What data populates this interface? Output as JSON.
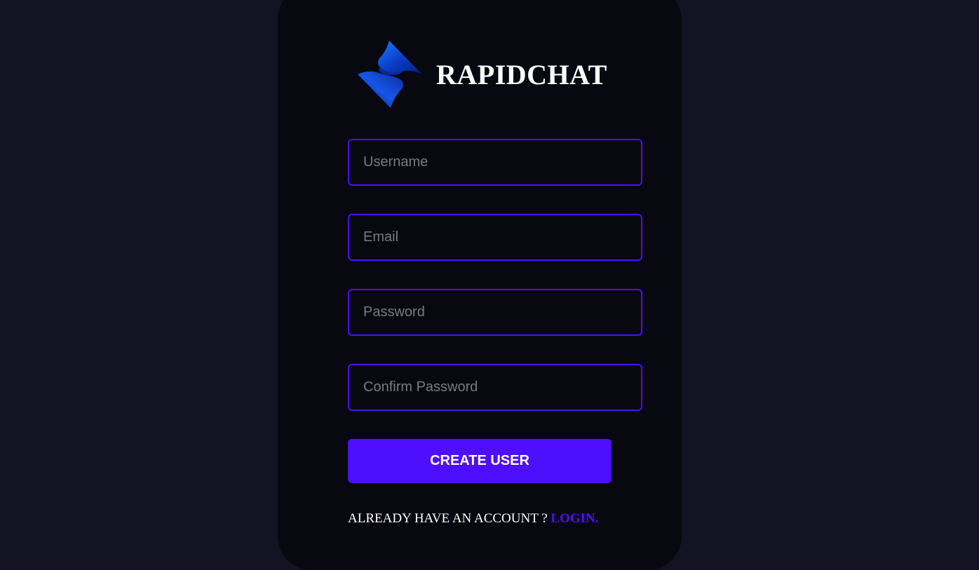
{
  "brand": {
    "name": "RAPIDCHAT",
    "logo_icon": "rapidchat-logo-icon"
  },
  "form": {
    "username_placeholder": "Username",
    "email_placeholder": "Email",
    "password_placeholder": "Password",
    "confirm_password_placeholder": "Confirm Password",
    "submit_label": "CREATE USER"
  },
  "footer": {
    "prompt": "ALREADY HAVE AN ACCOUNT ? ",
    "login_label": "LOGIN."
  },
  "colors": {
    "page_background": "#131324",
    "card_background": "#080810",
    "accent": "#4e0eff",
    "text": "#ffffff",
    "placeholder": "#7a7a80"
  }
}
